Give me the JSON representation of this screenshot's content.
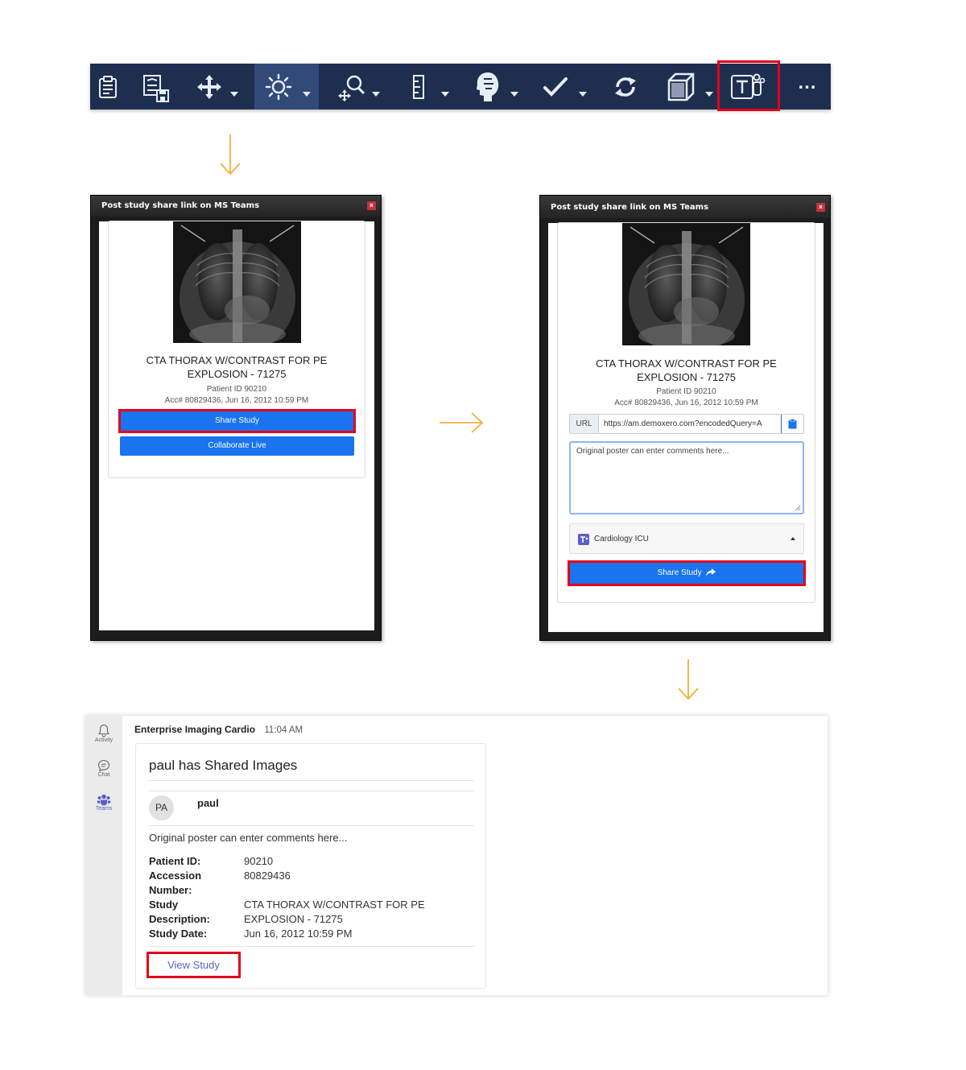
{
  "toolbar": {
    "items": [
      {
        "icon": "clipboard-icon",
        "has_dropdown": false
      },
      {
        "icon": "save-image-icon",
        "has_dropdown": false
      },
      {
        "icon": "pan-move-icon",
        "has_dropdown": true
      },
      {
        "icon": "brightness-icon",
        "has_dropdown": true,
        "active": true
      },
      {
        "icon": "zoom-icon",
        "has_dropdown": true
      },
      {
        "icon": "ruler-icon",
        "has_dropdown": true
      },
      {
        "icon": "head-anatomy-icon",
        "has_dropdown": true
      },
      {
        "icon": "checkmark-icon",
        "has_dropdown": true
      },
      {
        "icon": "sync-icon",
        "has_dropdown": false
      },
      {
        "icon": "3d-cube-icon",
        "has_dropdown": true
      },
      {
        "icon": "ms-teams-icon",
        "has_dropdown": false,
        "highlighted": true
      },
      {
        "icon": "more-options-icon",
        "label": "…"
      }
    ]
  },
  "dialog_left": {
    "title": "Post study share link on MS Teams",
    "close": "×",
    "study_title_line1": "CTA THORAX W/CONTRAST FOR PE",
    "study_title_line2": "EXPLOSION - 71275",
    "patient_id": "Patient ID 90210",
    "acc": "Acc# 80829436, Jun 16, 2012 10:59 PM",
    "share_button": "Share Study",
    "collaborate_button": "Collaborate Live"
  },
  "dialog_right": {
    "title": "Post study share link on MS Teams",
    "close": "×",
    "study_title_line1": "CTA THORAX W/CONTRAST FOR PE",
    "study_title_line2": "EXPLOSION - 71275",
    "patient_id": "Patient ID 90210",
    "acc": "Acc# 80829436, Jun 16, 2012 10:59 PM",
    "url_label": "URL",
    "url_value": "https://am.demoxero.com?encodedQuery=A",
    "comment_value": "Original poster can enter comments here...",
    "channel": "Cardiology ICU",
    "share_button": "Share Study"
  },
  "teams": {
    "rail": [
      {
        "icon": "bell-icon",
        "label": "Activity"
      },
      {
        "icon": "chat-icon",
        "label": "Chat"
      },
      {
        "icon": "teams-icon",
        "label": "Teams"
      }
    ],
    "sender": "Enterprise Imaging Cardio",
    "time": "11:04 AM",
    "card_title": "paul has Shared Images",
    "avatar_initials": "PA",
    "user": "paul",
    "comment": "Original poster can enter comments here...",
    "fields": {
      "patient_id_label": "Patient ID:",
      "patient_id": "90210",
      "accession_label_1": "Accession",
      "accession_label_2": "Number:",
      "accession": "80829436",
      "description_label_1": "Study",
      "description_label_2": "Description:",
      "description_1": "CTA THORAX W/CONTRAST FOR PE",
      "description_2": "EXPLOSION - 71275",
      "date_label": "Study Date:",
      "date": "Jun 16, 2012 10:59 PM"
    },
    "view_button": "View Study"
  },
  "colors": {
    "toolbar_bg": "#1e2e4f",
    "highlight_red": "#e3001b",
    "button_blue": "#1a73ef",
    "arrow_orange": "#f0b13c",
    "teams_purple": "#5b5fc7"
  }
}
